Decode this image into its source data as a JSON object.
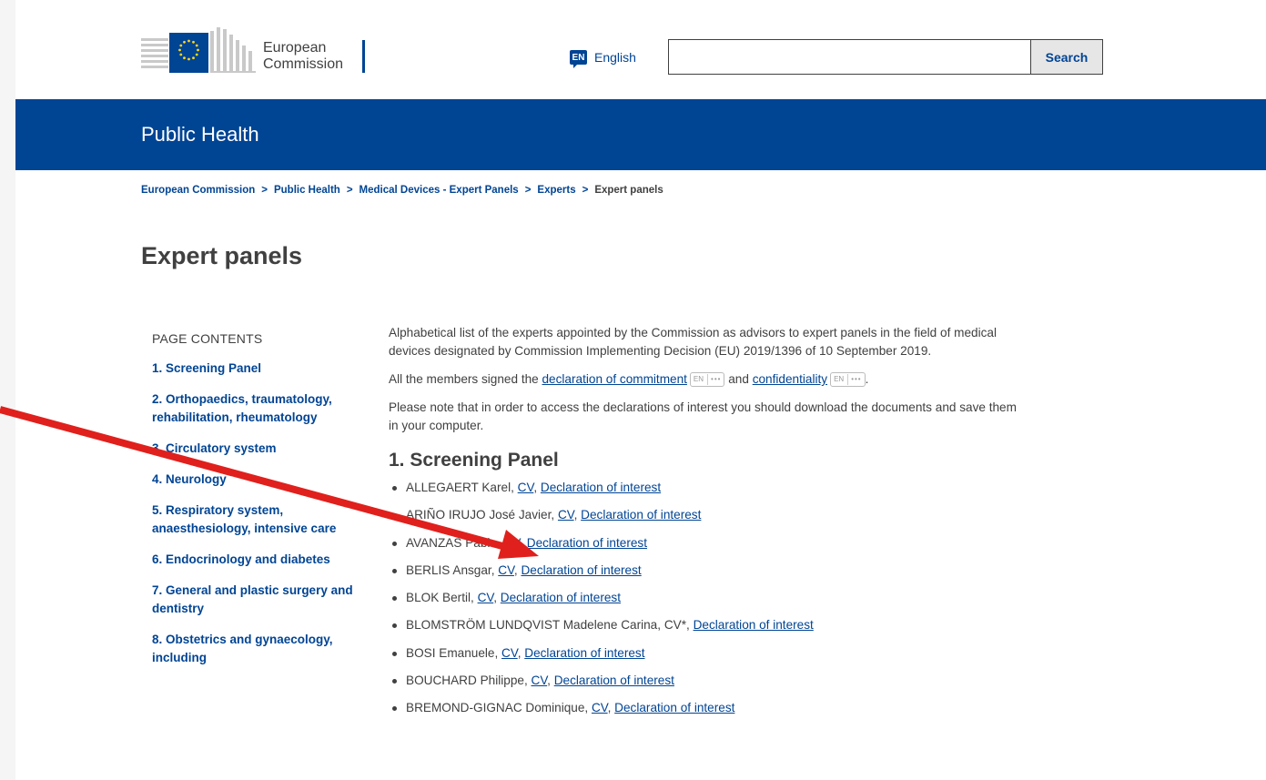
{
  "header": {
    "logo_line1": "European",
    "logo_line2": "Commission",
    "lang_code": "EN",
    "lang_label": "English",
    "search_value": "",
    "search_label": "Search"
  },
  "site": {
    "title": "Public Health"
  },
  "breadcrumb": [
    "European Commission",
    "Public Health",
    "Medical Devices - Expert Panels",
    "Experts",
    "Expert panels"
  ],
  "page_title": "Expert panels",
  "toc": {
    "heading": "PAGE CONTENTS",
    "items": [
      "1. Screening Panel",
      "2. Orthopaedics, traumatology, rehabilitation, rheumatology",
      "3. Circulatory system",
      "4. Neurology",
      "5. Respiratory system, anaesthesiology, intensive care",
      "6. Endocrinology and diabetes",
      "7. General and plastic surgery and dentistry",
      "8. Obstetrics and gynaecology, including"
    ]
  },
  "intro": {
    "p1": "Alphabetical list of the experts appointed by the Commission as advisors to expert panels in the field of medical devices designated by Commission Implementing Decision (EU) 2019/1396 of 10 September 2019.",
    "p2_before": "All the members signed the ",
    "p2_link1": "declaration of commitment",
    "p2_middle": " and ",
    "p2_link2": "confidentiality",
    "p2_after": ".",
    "badge_lang": "EN",
    "badge_dots": "•••",
    "p3": "Please note that in order to access the declarations of interest you should download the documents and save them in your computer."
  },
  "section1": {
    "heading": "1. Screening Panel",
    "experts": [
      {
        "name": "ALLEGAERT Karel",
        "cv": "CV",
        "cv_link": true,
        "doi": "Declaration of interest"
      },
      {
        "name": "ARIÑO IRUJO José Javier",
        "cv": "CV",
        "cv_link": true,
        "doi": "Declaration of interest"
      },
      {
        "name": "AVANZAS Pablo",
        "cv": "CV",
        "cv_link": true,
        "doi": "Declaration of interest"
      },
      {
        "name": "BERLIS Ansgar",
        "cv": "CV",
        "cv_link": true,
        "doi": "Declaration of interest"
      },
      {
        "name": "BLOK Bertil",
        "cv": "CV",
        "cv_link": true,
        "doi": "Declaration of interest"
      },
      {
        "name": "BLOMSTRÖM LUNDQVIST Madelene Carina",
        "cv": "CV*",
        "cv_link": false,
        "doi": "Declaration of interest"
      },
      {
        "name": "BOSI Emanuele",
        "cv": "CV",
        "cv_link": true,
        "doi": "Declaration of interest"
      },
      {
        "name": "BOUCHARD Philippe",
        "cv": "CV",
        "cv_link": true,
        "doi": "Declaration of interest"
      },
      {
        "name": "BREMOND-GIGNAC Dominique",
        "cv": "CV",
        "cv_link": true,
        "doi": "Declaration of interest"
      }
    ]
  },
  "colors": {
    "brand_blue": "#004494",
    "text": "#404040",
    "annotation_red": "#e0201c",
    "eu_yellow": "#ffd617"
  }
}
